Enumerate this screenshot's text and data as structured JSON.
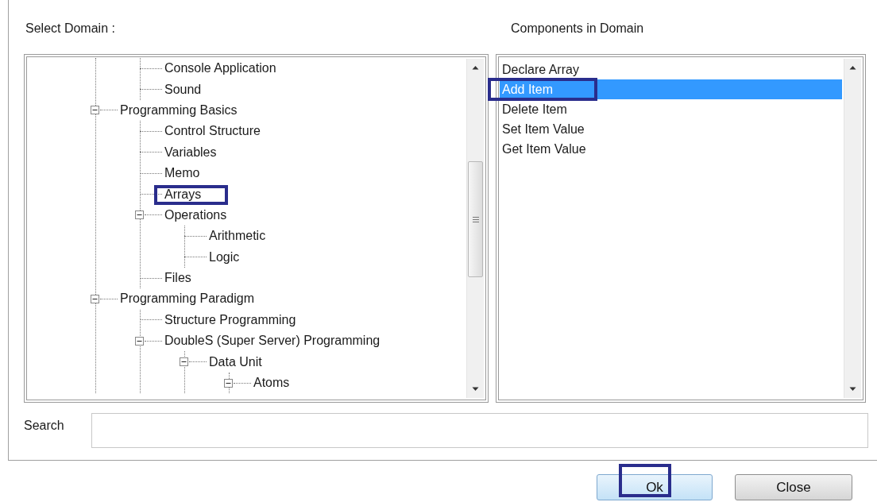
{
  "domain_label": "Select Domain :",
  "components_label": "Components in Domain",
  "domain_tree": [
    {
      "children": [
        {
          "label": "Console Application",
          "highlighted": false
        },
        {
          "label": "Sound",
          "highlighted": false
        }
      ]
    },
    {
      "label": "Programming Basics",
      "expanded": true,
      "highlighted": false,
      "children": [
        {
          "label": "Control Structure",
          "highlighted": false
        },
        {
          "label": "Variables",
          "highlighted": false
        },
        {
          "label": "Memo",
          "highlighted": false
        },
        {
          "label": "Arrays",
          "highlighted": true
        },
        {
          "label": "Operations",
          "expanded": true,
          "highlighted": false,
          "children": [
            {
              "label": "Arithmetic",
              "highlighted": false
            },
            {
              "label": "Logic",
              "highlighted": false
            }
          ]
        },
        {
          "label": "Files",
          "highlighted": false
        }
      ]
    },
    {
      "label": "Programming Paradigm",
      "expanded": true,
      "highlighted": false,
      "children": [
        {
          "label": "Structure Programming",
          "highlighted": false
        },
        {
          "label": "DoubleS (Super Server) Programming",
          "expanded": true,
          "highlighted": false,
          "children": [
            {
              "label": "Data Unit",
              "expanded": true,
              "highlighted": false,
              "children": [
                {
                  "label": "Atoms",
                  "expanded": true,
                  "highlighted": false
                }
              ]
            }
          ]
        }
      ]
    }
  ],
  "components": [
    {
      "label": "Declare Array",
      "selected": false,
      "highlighted": false
    },
    {
      "label": "Add Item",
      "selected": true,
      "highlighted": true
    },
    {
      "label": "Delete Item",
      "selected": false,
      "highlighted": false
    },
    {
      "label": "Set Item Value",
      "selected": false,
      "highlighted": false
    },
    {
      "label": "Get Item Value",
      "selected": false,
      "highlighted": false
    }
  ],
  "search": {
    "label": "Search"
  },
  "buttons": [
    {
      "label": "Ok",
      "kind": "primary",
      "highlighted": true
    },
    {
      "label": "Close",
      "kind": "secondary",
      "highlighted": false
    }
  ]
}
